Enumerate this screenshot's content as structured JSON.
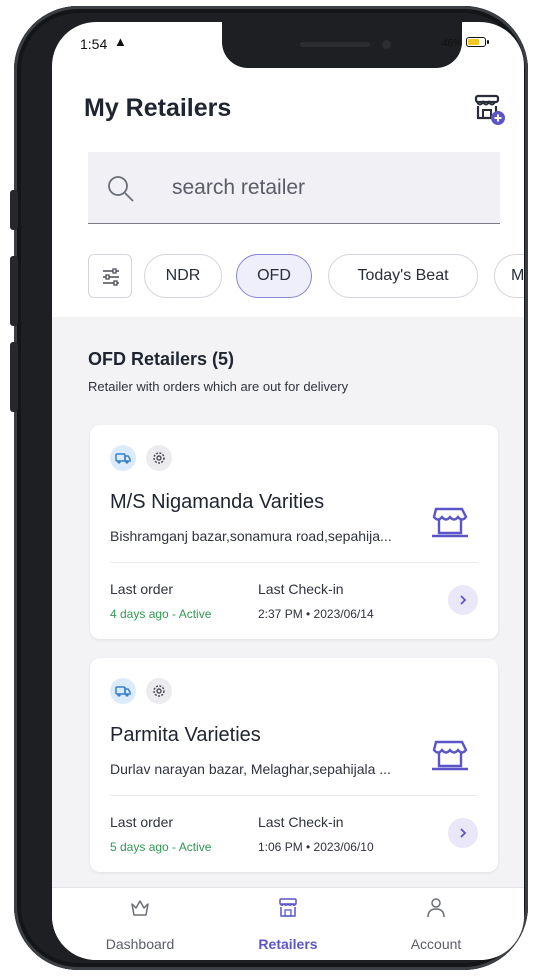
{
  "status_bar": {
    "time": "1:54",
    "battery": "46%"
  },
  "header": {
    "title": "My Retailers",
    "add_icon": "store-add-icon"
  },
  "search": {
    "placeholder": "search retailer"
  },
  "filters": {
    "icon": "filter-sliders-icon",
    "chips": [
      {
        "label": "NDR",
        "active": false
      },
      {
        "label": "OFD",
        "active": true
      },
      {
        "label": "Today's Beat",
        "active": false
      },
      {
        "label": "M",
        "active": false
      }
    ]
  },
  "section": {
    "title": "OFD Retailers (5)",
    "subtitle": "Retailer with orders which are out for delivery"
  },
  "retailers": [
    {
      "name": "M/S Nigamanda Varities",
      "address": "Bishramganj bazar,sonamura road,sepahija...",
      "last_order_label": "Last order",
      "last_order_value": "4 days ago - Active",
      "checkin_label": "Last Check-in",
      "checkin_value": "2:37 PM • 2023/06/14"
    },
    {
      "name": "Parmita Varieties",
      "address": "Durlav narayan bazar, Melaghar,sepahijala ...",
      "last_order_label": "Last order",
      "last_order_value": "5 days ago - Active",
      "checkin_label": "Last Check-in",
      "checkin_value": "1:06 PM • 2023/06/10"
    }
  ],
  "bottom_nav": [
    {
      "label": "Dashboard",
      "icon": "crown-icon",
      "active": false
    },
    {
      "label": "Retailers",
      "icon": "store-icon",
      "active": true
    },
    {
      "label": "Account",
      "icon": "person-icon",
      "active": false
    }
  ],
  "colors": {
    "accent": "#5b55c8",
    "active_green": "#2f9a52",
    "battery": "#f3c623"
  }
}
